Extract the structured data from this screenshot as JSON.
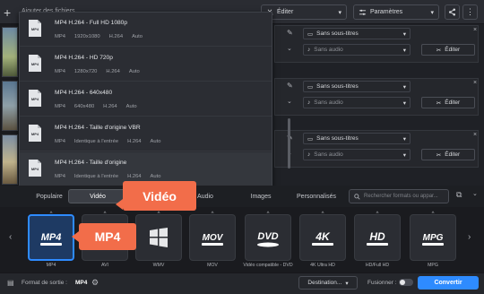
{
  "toolbar": {
    "add_files_label": "Ajouter des fichiers",
    "edit_label": "Éditer",
    "settings_label": "Paramètres"
  },
  "dropdown": {
    "items": [
      {
        "title": "MP4 H.264 - Full HD 1080p",
        "format": "MP4",
        "resolution": "1920x1080",
        "codec": "H.264",
        "quality": "Auto",
        "icon": "mp4-file-icon"
      },
      {
        "title": "MP4 H.264 - HD 720p",
        "format": "MP4",
        "resolution": "1280x720",
        "codec": "H.264",
        "quality": "Auto",
        "icon": "mp4-file-icon"
      },
      {
        "title": "MP4 H.264 - 640x480",
        "format": "MP4",
        "resolution": "640x480",
        "codec": "H.264",
        "quality": "Auto",
        "icon": "mp4-file-icon"
      },
      {
        "title": "MP4 H.264 - Taille d'origine VBR",
        "format": "MP4",
        "resolution": "Identique à l'entrée",
        "codec": "H.264",
        "quality": "Auto",
        "icon": "mp4-file-icon"
      },
      {
        "title": "MP4 H.264 - Taille d'origine",
        "format": "MP4",
        "resolution": "Identique à l'entrée",
        "codec": "H.264",
        "quality": "Auto",
        "icon": "mp4-file-icon"
      }
    ]
  },
  "rows": [
    {
      "subtitles": "Sans sous-titres",
      "audio": "Sans audio",
      "edit": "Éditer"
    },
    {
      "subtitles": "Sans sous-titres",
      "audio": "Sans audio",
      "edit": "Éditer"
    },
    {
      "subtitles": "Sans sous-titres",
      "audio": "Sans audio",
      "edit": "Éditer"
    }
  ],
  "tabs": [
    "Populaire",
    "Vidéo",
    "Audio",
    "Images",
    "Personnalisés"
  ],
  "active_tab": "Vidéo",
  "search_placeholder": "Rechercher formats ou appar...",
  "formats": [
    {
      "label": "MP4",
      "badge": "MP4",
      "selected": true
    },
    {
      "label": "AVI",
      "badge": "",
      "selected": false
    },
    {
      "label": "WMV",
      "badge": "",
      "selected": false
    },
    {
      "label": "MOV",
      "badge": "MOV",
      "selected": false
    },
    {
      "label": "Vidéo compatible - DVD",
      "badge": "DVD",
      "selected": false
    },
    {
      "label": "4K Ultra HD",
      "badge": "4K",
      "selected": false
    },
    {
      "label": "HD/Full HD",
      "badge": "HD",
      "selected": false
    },
    {
      "label": "MPG",
      "badge": "MPG",
      "selected": false
    }
  ],
  "callouts": {
    "video": "Vidéo",
    "mp4": "MP4"
  },
  "bottom": {
    "output_label": "Format de sortie :",
    "output_value": "MP4",
    "destination": "Destination...",
    "merge_label": "Fusionner :",
    "convert": "Convertir"
  },
  "colors": {
    "accent": "#2e8bff",
    "callout": "#f26d4a"
  }
}
